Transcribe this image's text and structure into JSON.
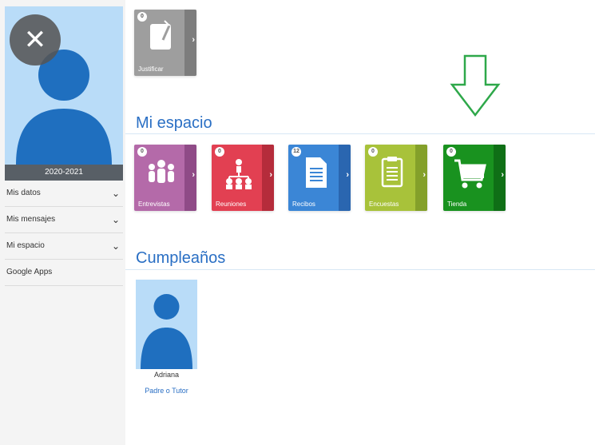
{
  "sidebar": {
    "year": "2020-2021",
    "items": [
      {
        "label": "Mis datos",
        "has_chevron": true
      },
      {
        "label": "Mis mensajes",
        "has_chevron": true
      },
      {
        "label": "Mi espacio",
        "has_chevron": true
      },
      {
        "label": "Google Apps",
        "has_chevron": false
      }
    ]
  },
  "tiles_top": [
    {
      "label": "Justificar",
      "badge": "0",
      "color": "#9e9e9e",
      "accent": "#7d7d7d",
      "icon": "document-pen-icon"
    }
  ],
  "mi_espacio": {
    "title": "Mi espacio",
    "tiles": [
      {
        "label": "Entrevistas",
        "badge": "0",
        "color": "#b46aa9",
        "accent": "#8f4b87",
        "icon": "people-icon"
      },
      {
        "label": "Reuniones",
        "badge": "0",
        "color": "#e24052",
        "accent": "#b52c3b",
        "icon": "meeting-icon"
      },
      {
        "label": "Recibos",
        "badge": "12",
        "color": "#3b86d6",
        "accent": "#2a66b0",
        "icon": "receipt-icon"
      },
      {
        "label": "Encuestas",
        "badge": "0",
        "color": "#a8c23a",
        "accent": "#84a02a",
        "icon": "clipboard-icon"
      },
      {
        "label": "Tienda",
        "badge": "0",
        "color": "#19921f",
        "accent": "#0f6f16",
        "icon": "cart-icon"
      }
    ]
  },
  "cumpleanos": {
    "title": "Cumpleaños",
    "person": {
      "name": "Adriana",
      "role": "Padre o Tutor"
    }
  },
  "icons": {
    "close": "close-icon",
    "chevron": "chevron-down-icon",
    "tile_arrow": "›",
    "down_arrow": "down-arrow-icon"
  },
  "colors": {
    "title_blue": "#2a6fc4",
    "avatar_bg": "#b9dcf8",
    "avatar_fg": "#1f6fbf",
    "arrow_green": "#2ea84a"
  }
}
